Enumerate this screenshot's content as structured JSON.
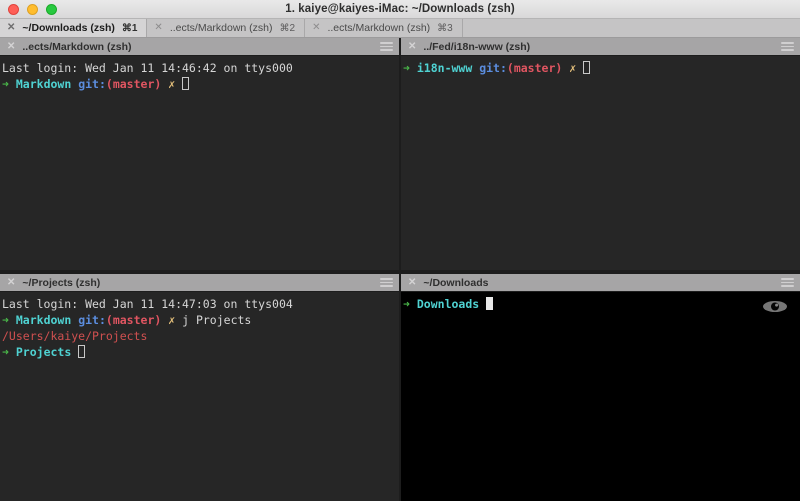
{
  "window": {
    "title": "1. kaiye@kaiyes-iMac: ~/Downloads (zsh)",
    "traffic_lights": {
      "close": "close-button",
      "minimize": "minimize-button",
      "maximize": "maximize-button"
    },
    "colors": {
      "titlebar": "#e3e2e3",
      "tabbar": "#c5c4c5",
      "pane_header": "#a6a5a6",
      "terminal_bg": "#262626",
      "terminal_bg_active": "#000000",
      "green": "#4ab84a",
      "cyan": "#4fd2d2",
      "blue": "#5b8dde",
      "red": "#e05561",
      "yellow": "#e5c07b",
      "path_red": "#d05050"
    }
  },
  "tabs": [
    {
      "close": "✕",
      "label": "~/Downloads (zsh)",
      "shortcut": "⌘1",
      "active": true
    },
    {
      "close": "✕",
      "label": "..ects/Markdown (zsh)",
      "shortcut": "⌘2",
      "active": false
    },
    {
      "close": "✕",
      "label": "..ects/Markdown (zsh)",
      "shortcut": "⌘3",
      "active": false
    }
  ],
  "panes": {
    "top_left": {
      "header": {
        "close": "✕",
        "title": "..ects/Markdown (zsh)",
        "menu": "hamburger-icon"
      },
      "lines": {
        "last_login": "Last login: Wed Jan 11 14:46:42 on ttys000",
        "arrow": "➜",
        "dir": "Markdown",
        "git": "git:",
        "branch": "(master)",
        "dirty": "✗"
      }
    },
    "top_right": {
      "header": {
        "close": "✕",
        "title": "../Fed/i18n-www (zsh)",
        "menu": "hamburger-icon"
      },
      "lines": {
        "arrow": "➜",
        "dir": "i18n-www",
        "git": "git:",
        "branch": "(master)",
        "dirty": "✗"
      }
    },
    "bottom_left": {
      "header": {
        "close": "✕",
        "title": "~/Projects (zsh)",
        "menu": "hamburger-icon"
      },
      "lines": {
        "last_login": "Last login: Wed Jan 11 14:47:03 on ttys004",
        "arrow": "➜",
        "dir": "Markdown",
        "git": "git:",
        "branch": "(master)",
        "dirty": "✗",
        "command": "j Projects",
        "output_path": "/Users/kaiye/Projects",
        "arrow2": "➜",
        "dir2": "Projects"
      }
    },
    "bottom_right": {
      "header": {
        "close": "✕",
        "title": "~/Downloads",
        "menu": "hamburger-icon"
      },
      "lines": {
        "arrow": "➜",
        "dir": "Downloads"
      },
      "badge": "eye-icon"
    }
  }
}
